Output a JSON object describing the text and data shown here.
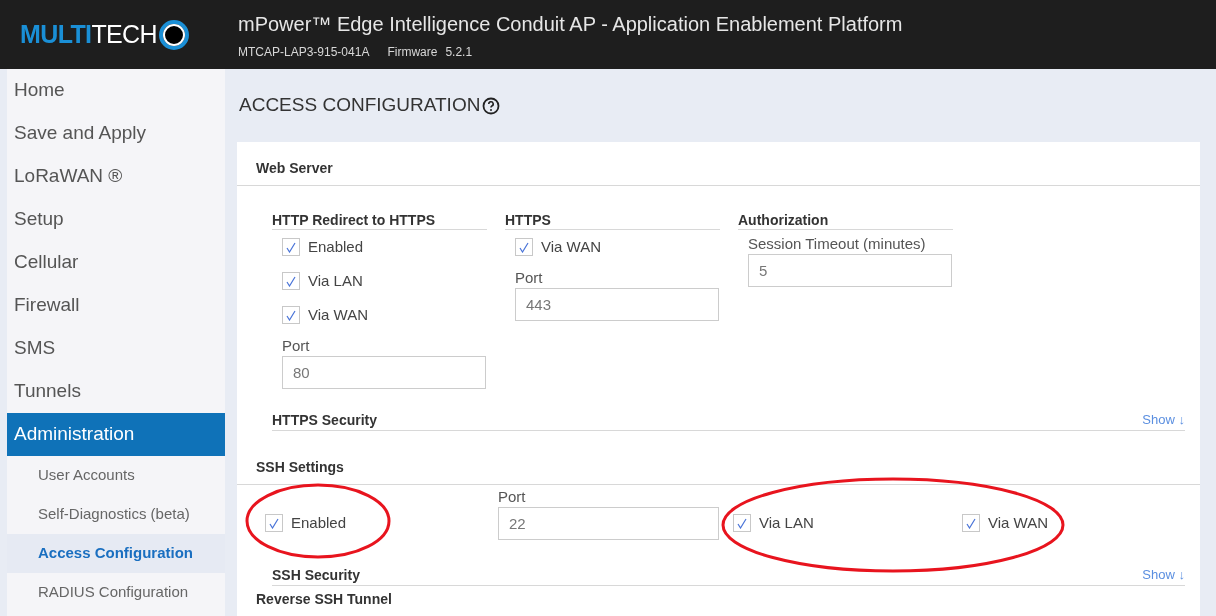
{
  "header": {
    "logo_bold": "MULTI",
    "logo_light": "TECH",
    "title": "mPower™ Edge Intelligence Conduit AP - Application Enablement Platform",
    "model": "MTCAP-LAP3-915-041A",
    "firmware_label": "Firmware",
    "firmware_version": "5.2.1"
  },
  "sidebar": [
    {
      "label": "Home",
      "selected": false
    },
    {
      "label": "Save and Apply",
      "selected": false
    },
    {
      "label": "LoRaWAN ®",
      "selected": false
    },
    {
      "label": "Setup",
      "selected": false
    },
    {
      "label": "Cellular",
      "selected": false
    },
    {
      "label": "Firewall",
      "selected": false
    },
    {
      "label": "SMS",
      "selected": false
    },
    {
      "label": "Tunnels",
      "selected": false
    },
    {
      "label": "Administration",
      "selected": true,
      "children": [
        {
          "label": "User Accounts",
          "selected": false
        },
        {
          "label": "Self-Diagnostics (beta)",
          "selected": false
        },
        {
          "label": "Access Configuration",
          "selected": true
        },
        {
          "label": "RADIUS Configuration",
          "selected": false
        }
      ]
    }
  ],
  "page_title": "ACCESS CONFIGURATION",
  "sections": [
    {
      "title": "Web Server",
      "kind": "groups",
      "groups": [
        {
          "title": "HTTP Redirect to HTTPS",
          "items": [
            {
              "kind": "checkbox",
              "label": "Enabled",
              "checked": true
            },
            {
              "kind": "checkbox",
              "label": "Via LAN",
              "checked": true
            },
            {
              "kind": "checkbox",
              "label": "Via WAN",
              "checked": true
            },
            {
              "kind": "field",
              "label": "Port",
              "value": "80"
            }
          ]
        },
        {
          "title": "HTTPS",
          "items": [
            {
              "kind": "checkbox",
              "label": "Via WAN",
              "checked": true
            },
            {
              "kind": "field",
              "label": "Port",
              "value": "443"
            }
          ]
        },
        {
          "title": "Authorization",
          "items": [
            {
              "kind": "field",
              "label": "Session Timeout (minutes)",
              "value": "5"
            }
          ]
        }
      ],
      "subsections": [
        {
          "title": "HTTPS Security",
          "link": "Show ↓"
        }
      ]
    },
    {
      "title": "SSH Settings",
      "kind": "row",
      "items": [
        {
          "kind": "checkbox",
          "label": "Enabled",
          "checked": true
        },
        {
          "kind": "field",
          "label": "Port",
          "value": "22"
        },
        {
          "kind": "checkbox",
          "label": "Via LAN",
          "checked": true
        },
        {
          "kind": "checkbox",
          "label": "Via WAN",
          "checked": true
        }
      ],
      "subsections": [
        {
          "title": "SSH Security",
          "link": "Show ↓"
        }
      ]
    },
    {
      "title": "Reverse SSH Tunnel",
      "kind": "heading"
    }
  ]
}
